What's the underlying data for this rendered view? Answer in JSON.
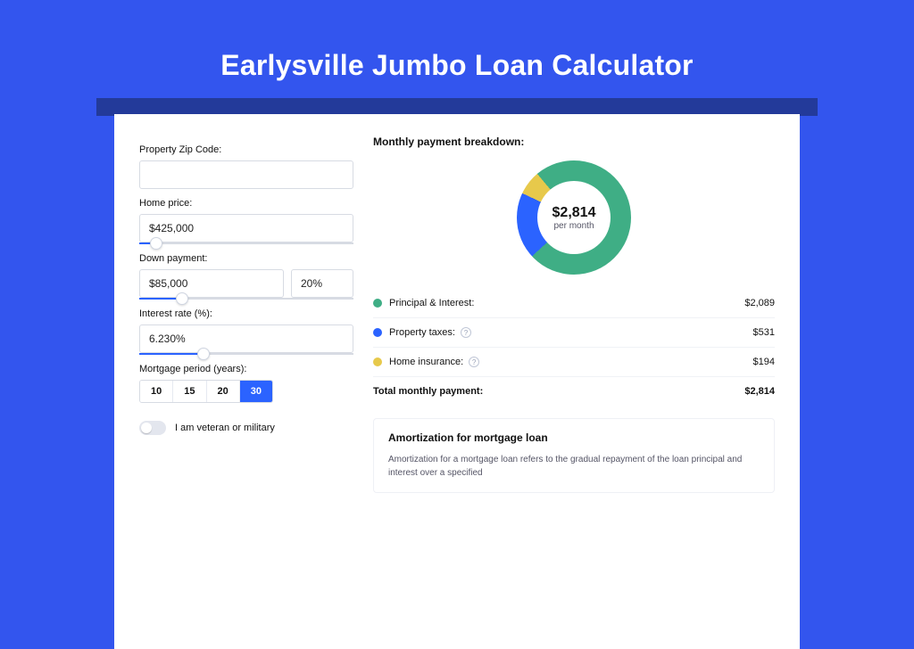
{
  "colors": {
    "principal": "#3fae85",
    "taxes": "#2b63ff",
    "insurance": "#e7c94b"
  },
  "header": {
    "title": "Earlysville Jumbo Loan Calculator"
  },
  "form": {
    "zip": {
      "label": "Property Zip Code:",
      "value": ""
    },
    "homePrice": {
      "label": "Home price:",
      "value": "$425,000",
      "sliderPct": 8
    },
    "downPayment": {
      "label": "Down payment:",
      "value": "$85,000",
      "pct": "20%",
      "sliderPct": 20
    },
    "rate": {
      "label": "Interest rate (%):",
      "value": "6.230%",
      "sliderPct": 30
    },
    "period": {
      "label": "Mortgage period (years):",
      "options": [
        "10",
        "15",
        "20",
        "30"
      ],
      "active": "30"
    },
    "veteran": {
      "label": "I am veteran or military",
      "on": false
    }
  },
  "breakdown": {
    "title": "Monthly payment breakdown:",
    "centerAmount": "$2,814",
    "centerLabel": "per month",
    "rows": [
      {
        "name": "Principal & Interest:",
        "value": "$2,089",
        "colorKey": "principal",
        "help": false
      },
      {
        "name": "Property taxes:",
        "value": "$531",
        "colorKey": "taxes",
        "help": true
      },
      {
        "name": "Home insurance:",
        "value": "$194",
        "colorKey": "insurance",
        "help": true
      }
    ],
    "total": {
      "name": "Total monthly payment:",
      "value": "$2,814"
    }
  },
  "amortization": {
    "title": "Amortization for mortgage loan",
    "text": "Amortization for a mortgage loan refers to the gradual repayment of the loan principal and interest over a specified"
  },
  "chart_data": {
    "type": "pie",
    "title": "Monthly payment breakdown",
    "categories": [
      "Principal & Interest",
      "Property taxes",
      "Home insurance"
    ],
    "values": [
      2089,
      531,
      194
    ],
    "total": 2814,
    "center_label": "$2,814 per month"
  }
}
